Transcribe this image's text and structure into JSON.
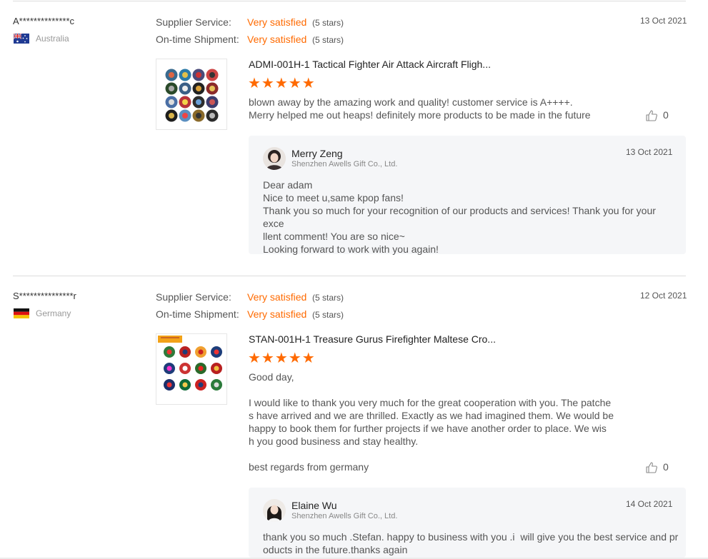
{
  "reviews": [
    {
      "reviewer": "A**************c",
      "country": "Australia",
      "supplier_label": "Supplier Service:",
      "supplier_rating": "Very satisfied",
      "supplier_stars": "(5 stars)",
      "shipment_label": "On-time Shipment:",
      "shipment_rating": "Very satisfied",
      "shipment_stars": "(5 stars)",
      "date": "13 Oct 2021",
      "product_title": "ADMI-001H-1 Tactical Fighter Air Attack Aircraft Fligh...",
      "stars": "★★★★★",
      "text": "blown away by the amazing work and quality! customer service is A++++.\nMerry helped me out heaps! definitely more products to be made in the future",
      "likes": "0",
      "reply": {
        "name": "Merry Zeng",
        "company": "Shenzhen Awells Gift Co., Ltd.",
        "date": "13 Oct 2021",
        "text": "Dear adam\nNice to meet u,same kpop fans!\nThank you so much for your recognition of our products and services! Thank you for your exce\nllent comment! You are so nice~\nLooking forward to work with you again!"
      }
    },
    {
      "reviewer": "S***************r",
      "country": "Germany",
      "supplier_label": "Supplier Service:",
      "supplier_rating": "Very satisfied",
      "supplier_stars": "(5 stars)",
      "shipment_label": "On-time Shipment:",
      "shipment_rating": "Very satisfied",
      "shipment_stars": "(5 stars)",
      "date": "12 Oct 2021",
      "product_title": "STAN-001H-1 Treasure Gurus Firefighter Maltese Cro...",
      "stars": "★★★★★",
      "text": "Good day,\n\nI would like to thank you very much for the great cooperation with you. The patche\ns have arrived and we are thrilled. Exactly as we had imagined them. We would be\nhappy to book them for further projects if we have another order to place. We wis\nh you good business and stay healthy.\n\nbest regards from germany",
      "likes": "0",
      "reply": {
        "name": "Elaine Wu",
        "company": "Shenzhen Awells Gift Co., Ltd.",
        "date": "14 Oct 2021",
        "text": "thank you so much .Stefan. happy to business with you .i  will give you the best service and pr\noducts in the future.thanks again"
      }
    }
  ],
  "icons": {
    "like": "thumbs-up-icon",
    "flag_au": "australia-flag-icon",
    "flag_de": "germany-flag-icon"
  },
  "colors": {
    "accent": "#ff6a00",
    "reply_bg": "#f5f6f8"
  }
}
